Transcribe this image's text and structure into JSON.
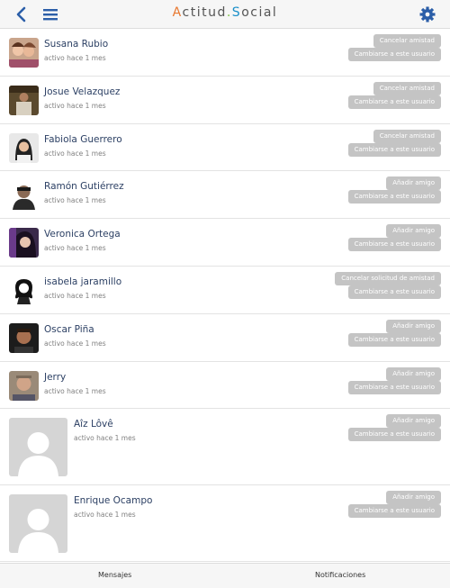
{
  "header": {
    "logo_a": "A",
    "logo_rest1": "ctitud",
    "logo_dot": ".",
    "logo_s": "S",
    "logo_rest2": "ocial",
    "back_icon": "chevron-left-icon",
    "menu_icon": "hamburger-icon",
    "settings_icon": "gear-icon"
  },
  "colors": {
    "accent": "#2b5ea8",
    "button_bg": "#c4c4c4",
    "name_text": "#2b3f63"
  },
  "users": [
    {
      "name": "Susana Rubio",
      "status": "activo hace 1 mes",
      "action": "Cancelar amistad",
      "switch": "Cambiarse a este usuario"
    },
    {
      "name": "Josue Velazquez",
      "status": "activo hace 1 mes",
      "action": "Cancelar amistad",
      "switch": "Cambiarse a este usuario"
    },
    {
      "name": "Fabiola Guerrero",
      "status": "activo hace 1 mes",
      "action": "Cancelar amistad",
      "switch": "Cambiarse a este usuario"
    },
    {
      "name": "Ramón Gutiérrez",
      "status": "activo hace 1 mes",
      "action": "Añadir amigo",
      "switch": "Cambiarse a este usuario"
    },
    {
      "name": "Veronica Ortega",
      "status": "activo hace 1 mes",
      "action": "Añadir amigo",
      "switch": "Cambiarse a este usuario"
    },
    {
      "name": "isabela jaramillo",
      "status": "activo hace 1 mes",
      "action": "Cancelar solicitud de amistad",
      "switch": "Cambiarse a este usuario"
    },
    {
      "name": "Oscar Piña",
      "status": "activo hace 1 mes",
      "action": "Añadir amigo",
      "switch": "Cambiarse a este usuario"
    },
    {
      "name": "Jerry",
      "status": "activo hace 1 mes",
      "action": "Añadir amigo",
      "switch": "Cambiarse a este usuario"
    },
    {
      "name": "Aîz Lôvê",
      "status": "activo hace 1 mes",
      "action": "Añadir amigo",
      "switch": "Cambiarse a este usuario"
    },
    {
      "name": "Enrique Ocampo",
      "status": "activo hace 1 mes",
      "action": "Añadir amigo",
      "switch": "Cambiarse a este usuario"
    }
  ],
  "footer": {
    "tab_messages": "Mensajes",
    "tab_notifications": "Notificaciones"
  }
}
